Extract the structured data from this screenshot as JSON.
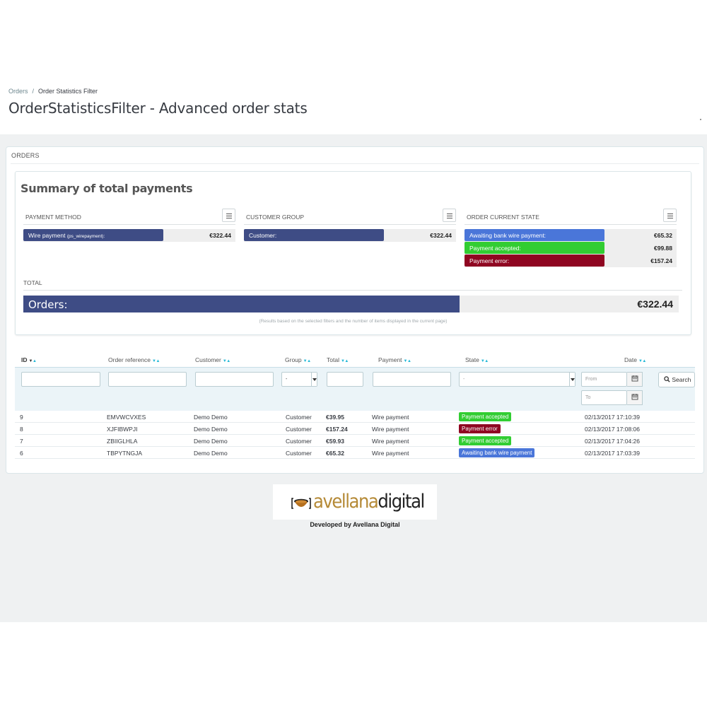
{
  "breadcrumb": {
    "parent": "Orders",
    "separator": "/",
    "current": "Order Statistics Filter"
  },
  "page": {
    "title": "OrderStatisticsFilter - Advanced order stats"
  },
  "orders_panel": {
    "heading": "ORDERS"
  },
  "summary": {
    "title": "Summary of total payments",
    "payment_method": {
      "heading": "PAYMENT METHOD",
      "rows": [
        {
          "label": "Wire payment",
          "sublabel": "(ps_wirepayment):",
          "amount": "€322.44",
          "color": "#3e4c85",
          "share": 0.66
        }
      ]
    },
    "customer_group": {
      "heading": "CUSTOMER GROUP",
      "rows": [
        {
          "label": "Customer:",
          "amount": "€322.44",
          "color": "#3e4c85",
          "share": 0.66
        }
      ]
    },
    "order_state": {
      "heading": "ORDER CURRENT STATE",
      "rows": [
        {
          "label": "Awaiting bank wire payment:",
          "amount": "€65.32",
          "color": "#4a76d9",
          "share": 0.66
        },
        {
          "label": "Payment accepted:",
          "amount": "€99.88",
          "color": "#32cd32",
          "share": 0.66
        },
        {
          "label": "Payment error:",
          "amount": "€157.24",
          "color": "#8f0621",
          "share": 0.66
        }
      ]
    },
    "total": {
      "heading": "TOTAL",
      "label": "Orders:",
      "amount": "€322.44",
      "color": "#3e4c85",
      "share": 0.666
    },
    "note": "(Results based on the selected filters and the number of items displayed in the current page)"
  },
  "table": {
    "columns": {
      "id": "ID",
      "reference": "Order reference",
      "customer": "Customer",
      "group": "Group",
      "total": "Total",
      "payment": "Payment",
      "state": "State",
      "date": "Date"
    },
    "filters": {
      "group_value": "-",
      "state_value": "-",
      "date_from_placeholder": "From",
      "date_to_placeholder": "To",
      "search_label": "Search"
    },
    "rows": [
      {
        "id": "9",
        "reference": "EMVWCVXES",
        "customer": "Demo Demo",
        "group": "Customer",
        "total": "€39.95",
        "payment": "Wire payment",
        "state": "Payment accepted",
        "state_color": "#32cd32",
        "date": "02/13/2017 17:10:39"
      },
      {
        "id": "8",
        "reference": "XJFIBWPJI",
        "customer": "Demo Demo",
        "group": "Customer",
        "total": "€157.24",
        "payment": "Wire payment",
        "state": "Payment error",
        "state_color": "#8f0621",
        "date": "02/13/2017 17:08:06"
      },
      {
        "id": "7",
        "reference": "ZBIIGLHLA",
        "customer": "Demo Demo",
        "group": "Customer",
        "total": "€59.93",
        "payment": "Wire payment",
        "state": "Payment accepted",
        "state_color": "#32cd32",
        "date": "02/13/2017 17:04:26"
      },
      {
        "id": "6",
        "reference": "TBPYTNGJA",
        "customer": "Demo Demo",
        "group": "Customer",
        "total": "€65.32",
        "payment": "Wire payment",
        "state": "Awaiting bank wire payment",
        "state_color": "#4a76d9",
        "date": "02/13/2017 17:03:39"
      }
    ]
  },
  "footer": {
    "logo_word_1": "avellana",
    "logo_word_2": "digital",
    "developed_by": "Developed by Avellana Digital"
  },
  "icons": {
    "list": "list-icon",
    "calendar": "calendar-icon",
    "search": "search-icon"
  }
}
